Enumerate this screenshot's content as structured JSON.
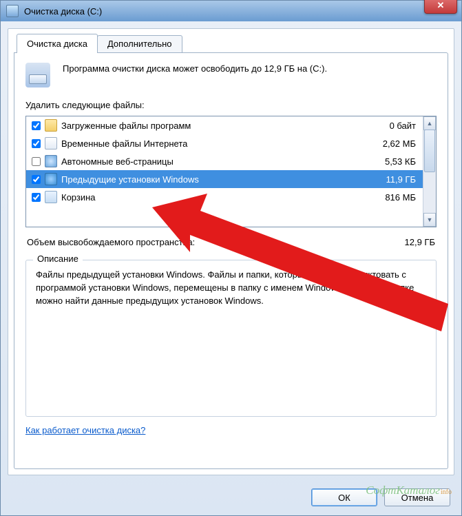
{
  "window": {
    "title": "Очистка диска  (C:)"
  },
  "tabs": {
    "main": "Очистка диска",
    "advanced": "Дополнительно"
  },
  "summary": "Программа очистки диска может освободить до 12,9 ГБ на  (C:).",
  "delete_label": "Удалить следующие файлы:",
  "items": [
    {
      "name": "Загруженные файлы программ",
      "size": "0 байт",
      "checked": true,
      "icon": "folder",
      "selected": false
    },
    {
      "name": "Временные файлы Интернета",
      "size": "2,62 МБ",
      "checked": true,
      "icon": "page",
      "selected": false
    },
    {
      "name": "Автономные веб-страницы",
      "size": "5,53 КБ",
      "checked": false,
      "icon": "globe",
      "selected": false
    },
    {
      "name": "Предыдущие установки Windows",
      "size": "11,9 ГБ",
      "checked": true,
      "icon": "win",
      "selected": true
    },
    {
      "name": "Корзина",
      "size": "816 МБ",
      "checked": true,
      "icon": "bin",
      "selected": false
    }
  ],
  "total": {
    "label": "Объем высвобождаемого пространства:",
    "value": "12,9 ГБ"
  },
  "description": {
    "title": "Описание",
    "text": "Файлы предыдущей установки Windows.   Файлы и папки, которые могут конфликтовать с программой установки Windows, перемещены в папку с именем Windows.old. В этой папке можно найти данные предыдущих установок Windows."
  },
  "help_link": "Как работает очистка диска?",
  "buttons": {
    "ok": "ОК",
    "cancel": "Отмена"
  },
  "watermark": {
    "main": "СофтКаталог",
    "suffix": "info"
  }
}
